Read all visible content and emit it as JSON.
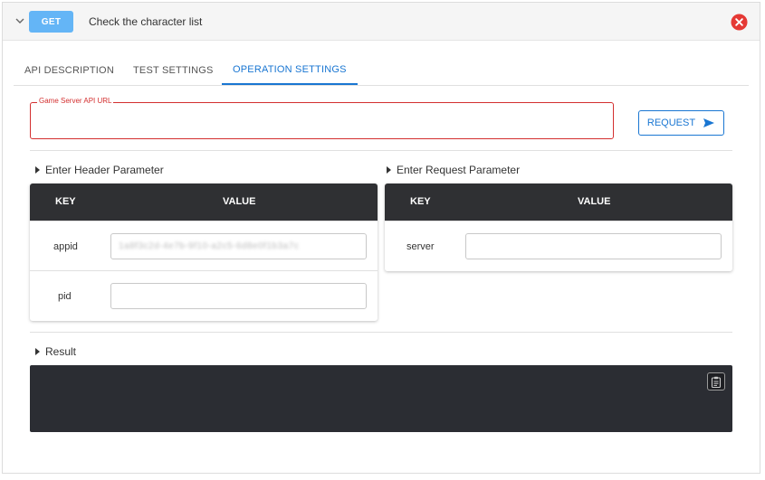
{
  "header": {
    "method": "GET",
    "title": "Check the character list"
  },
  "tabs": [
    {
      "label": "API DESCRIPTION",
      "active": false
    },
    {
      "label": "TEST SETTINGS",
      "active": false
    },
    {
      "label": "OPERATION SETTINGS",
      "active": true
    }
  ],
  "url_field": {
    "label": "Game Server API URL",
    "value": ""
  },
  "request_button": {
    "label": "REQUEST"
  },
  "header_params": {
    "title": "Enter Header Parameter",
    "col_key": "KEY",
    "col_value": "VALUE",
    "rows": [
      {
        "key": "appid",
        "value": "1a8f3c2d-4e7b-9f10-a2c5-6d8e0f1b3a7c"
      },
      {
        "key": "pid",
        "value": ""
      }
    ]
  },
  "request_params": {
    "title": "Enter Request Parameter",
    "col_key": "KEY",
    "col_value": "VALUE",
    "rows": [
      {
        "key": "server",
        "value": ""
      }
    ]
  },
  "result": {
    "title": "Result",
    "content": ""
  },
  "colors": {
    "accent": "#1976d2",
    "badge": "#64b5f6",
    "error": "#d32f2f",
    "dark": "#2f3033"
  }
}
